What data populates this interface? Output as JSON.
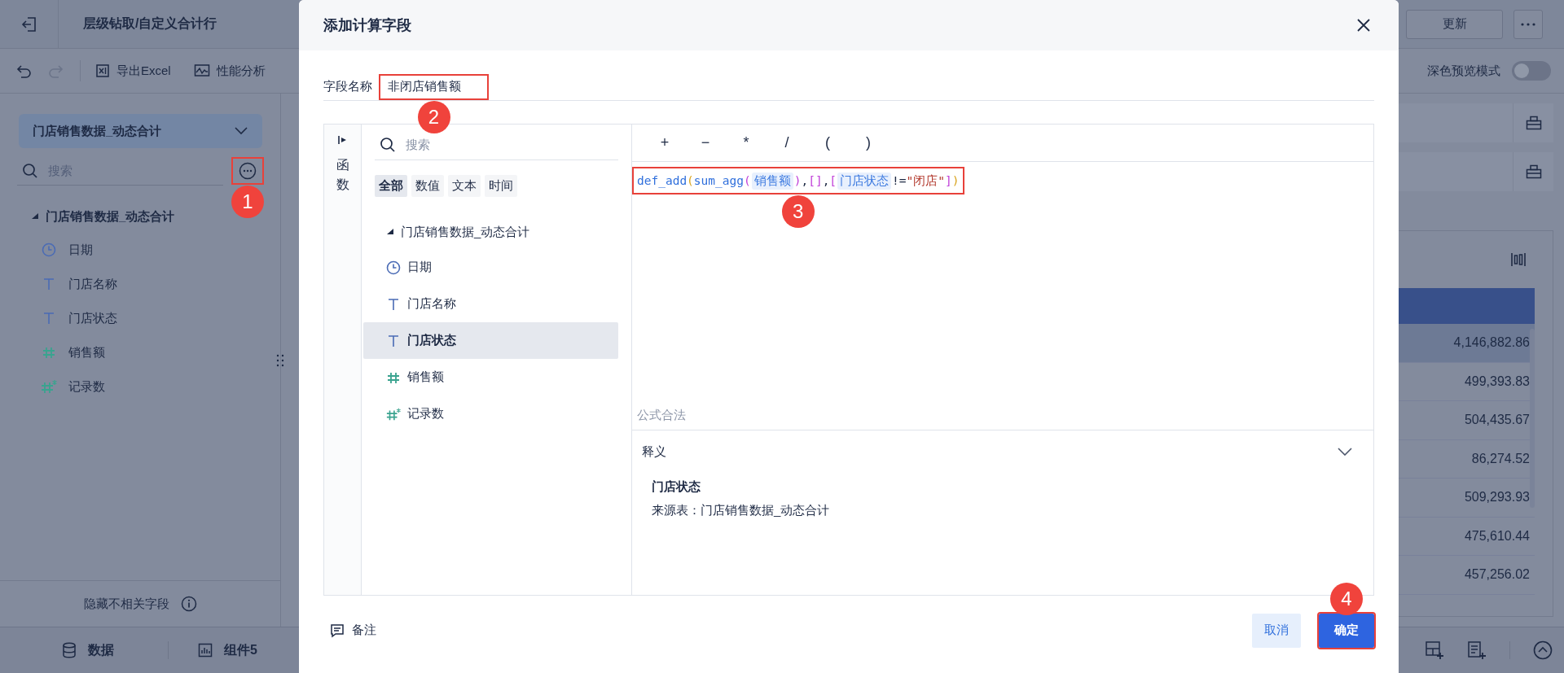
{
  "app": {
    "title": "层级钻取/自定义合计行",
    "toolbar": [
      {
        "kind": "export",
        "label": "导出Excel"
      },
      {
        "kind": "analysis",
        "label": "性能分析"
      }
    ],
    "update_button": "更新",
    "dark_preview": {
      "label": "深色预览模式",
      "on": false
    }
  },
  "sidebar": {
    "dataset": "门店销售数据_动态合计",
    "search_placeholder": "搜索",
    "more_button": {
      "highlighted": true,
      "marker": "1"
    },
    "tree": {
      "label": "门店销售数据_动态合计",
      "expanded": true,
      "children": [
        {
          "label": "日期",
          "kind": "date"
        },
        {
          "label": "门店名称",
          "kind": "text"
        },
        {
          "label": "门店状态",
          "kind": "text"
        },
        {
          "label": "销售额",
          "kind": "number"
        },
        {
          "label": "记录数",
          "kind": "count"
        }
      ]
    },
    "footer": "隐藏不相关字段"
  },
  "bottom_bar": {
    "tabs": [
      {
        "kind": "data",
        "label": "数据"
      },
      {
        "kind": "component",
        "label": "组件5"
      }
    ]
  },
  "table": {
    "values": [
      "4,146,882.86",
      "499,393.83",
      "504,435.67",
      "86,274.52",
      "509,293.93",
      "475,610.44",
      "457,256.02"
    ]
  },
  "dialog": {
    "title": "添加计算字段",
    "field_name": {
      "label": "字段名称",
      "value": "非闭店销售额",
      "highlighted": true,
      "marker": "2"
    },
    "side_tab": "函数",
    "field_panel": {
      "search_placeholder": "搜索",
      "tabs": [
        {
          "label": "全部",
          "selected": true
        },
        {
          "label": "数值",
          "selected": false
        },
        {
          "label": "文本",
          "selected": false
        },
        {
          "label": "时间",
          "selected": false
        }
      ],
      "tree": {
        "label": "门店销售数据_动态合计",
        "expanded": true,
        "children": [
          {
            "label": "日期",
            "kind": "date",
            "selected": false
          },
          {
            "label": "门店名称",
            "kind": "text",
            "selected": false
          },
          {
            "label": "门店状态",
            "kind": "text",
            "selected": true
          },
          {
            "label": "销售额",
            "kind": "number",
            "selected": false
          },
          {
            "label": "记录数",
            "kind": "count",
            "selected": false
          }
        ]
      }
    },
    "operators": [
      "+",
      "−",
      "*",
      "/",
      "(",
      ")"
    ],
    "formula": {
      "highlighted": true,
      "marker": "3",
      "tokens": [
        {
          "kind": "function",
          "text": "def_add"
        },
        {
          "kind": "bracket",
          "text": "(",
          "color": "#d9a520"
        },
        {
          "kind": "function",
          "text": "sum_agg"
        },
        {
          "kind": "bracket",
          "text": "(",
          "color": "#c041d9"
        },
        {
          "kind": "field",
          "text": "销售额"
        },
        {
          "kind": "bracket",
          "text": ")",
          "color": "#c041d9"
        },
        {
          "kind": "plain",
          "text": ","
        },
        {
          "kind": "bracket",
          "text": "[]",
          "color": "#c041d9"
        },
        {
          "kind": "plain",
          "text": ","
        },
        {
          "kind": "bracket",
          "text": "[",
          "color": "#c041d9"
        },
        {
          "kind": "field",
          "text": "门店状态"
        },
        {
          "kind": "plain",
          "text": "!="
        },
        {
          "kind": "string",
          "text": "\"闭店\""
        },
        {
          "kind": "bracket",
          "text": "]",
          "color": "#c041d9"
        },
        {
          "kind": "bracket",
          "text": ")",
          "color": "#d9a520"
        }
      ]
    },
    "status": "公式合法",
    "explanation": {
      "label": "释义",
      "expanded": true,
      "name": "门店状态",
      "source": "来源表：门店销售数据_动态合计"
    },
    "note_button": "备注",
    "buttons": [
      {
        "kind": "cancel",
        "label": "取消"
      },
      {
        "kind": "confirm",
        "label": "确定",
        "highlighted": true,
        "marker": "4"
      }
    ]
  }
}
